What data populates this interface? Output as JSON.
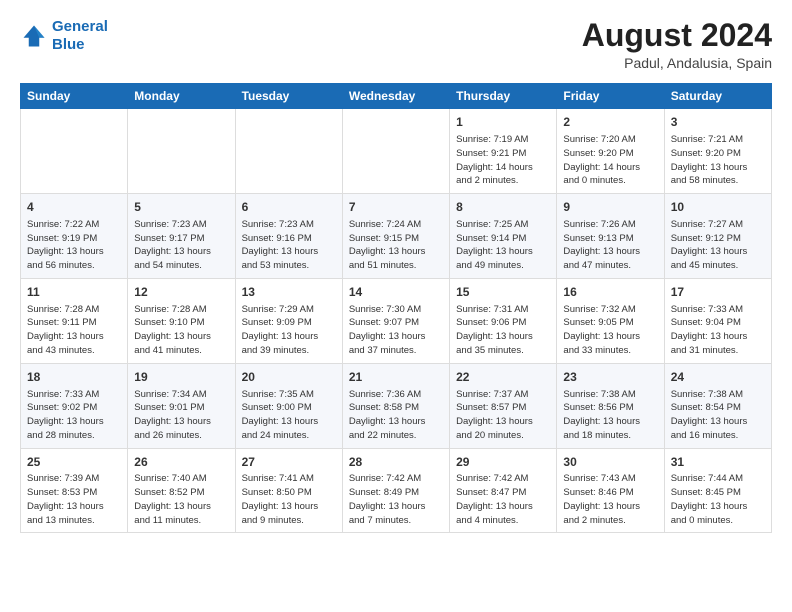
{
  "header": {
    "logo_line1": "General",
    "logo_line2": "Blue",
    "title": "August 2024",
    "subtitle": "Padul, Andalusia, Spain"
  },
  "calendar": {
    "days_of_week": [
      "Sunday",
      "Monday",
      "Tuesday",
      "Wednesday",
      "Thursday",
      "Friday",
      "Saturday"
    ],
    "weeks": [
      [
        {
          "day": "",
          "info": ""
        },
        {
          "day": "",
          "info": ""
        },
        {
          "day": "",
          "info": ""
        },
        {
          "day": "",
          "info": ""
        },
        {
          "day": "1",
          "info": "Sunrise: 7:19 AM\nSunset: 9:21 PM\nDaylight: 14 hours\nand 2 minutes."
        },
        {
          "day": "2",
          "info": "Sunrise: 7:20 AM\nSunset: 9:20 PM\nDaylight: 14 hours\nand 0 minutes."
        },
        {
          "day": "3",
          "info": "Sunrise: 7:21 AM\nSunset: 9:20 PM\nDaylight: 13 hours\nand 58 minutes."
        }
      ],
      [
        {
          "day": "4",
          "info": "Sunrise: 7:22 AM\nSunset: 9:19 PM\nDaylight: 13 hours\nand 56 minutes."
        },
        {
          "day": "5",
          "info": "Sunrise: 7:23 AM\nSunset: 9:17 PM\nDaylight: 13 hours\nand 54 minutes."
        },
        {
          "day": "6",
          "info": "Sunrise: 7:23 AM\nSunset: 9:16 PM\nDaylight: 13 hours\nand 53 minutes."
        },
        {
          "day": "7",
          "info": "Sunrise: 7:24 AM\nSunset: 9:15 PM\nDaylight: 13 hours\nand 51 minutes."
        },
        {
          "day": "8",
          "info": "Sunrise: 7:25 AM\nSunset: 9:14 PM\nDaylight: 13 hours\nand 49 minutes."
        },
        {
          "day": "9",
          "info": "Sunrise: 7:26 AM\nSunset: 9:13 PM\nDaylight: 13 hours\nand 47 minutes."
        },
        {
          "day": "10",
          "info": "Sunrise: 7:27 AM\nSunset: 9:12 PM\nDaylight: 13 hours\nand 45 minutes."
        }
      ],
      [
        {
          "day": "11",
          "info": "Sunrise: 7:28 AM\nSunset: 9:11 PM\nDaylight: 13 hours\nand 43 minutes."
        },
        {
          "day": "12",
          "info": "Sunrise: 7:28 AM\nSunset: 9:10 PM\nDaylight: 13 hours\nand 41 minutes."
        },
        {
          "day": "13",
          "info": "Sunrise: 7:29 AM\nSunset: 9:09 PM\nDaylight: 13 hours\nand 39 minutes."
        },
        {
          "day": "14",
          "info": "Sunrise: 7:30 AM\nSunset: 9:07 PM\nDaylight: 13 hours\nand 37 minutes."
        },
        {
          "day": "15",
          "info": "Sunrise: 7:31 AM\nSunset: 9:06 PM\nDaylight: 13 hours\nand 35 minutes."
        },
        {
          "day": "16",
          "info": "Sunrise: 7:32 AM\nSunset: 9:05 PM\nDaylight: 13 hours\nand 33 minutes."
        },
        {
          "day": "17",
          "info": "Sunrise: 7:33 AM\nSunset: 9:04 PM\nDaylight: 13 hours\nand 31 minutes."
        }
      ],
      [
        {
          "day": "18",
          "info": "Sunrise: 7:33 AM\nSunset: 9:02 PM\nDaylight: 13 hours\nand 28 minutes."
        },
        {
          "day": "19",
          "info": "Sunrise: 7:34 AM\nSunset: 9:01 PM\nDaylight: 13 hours\nand 26 minutes."
        },
        {
          "day": "20",
          "info": "Sunrise: 7:35 AM\nSunset: 9:00 PM\nDaylight: 13 hours\nand 24 minutes."
        },
        {
          "day": "21",
          "info": "Sunrise: 7:36 AM\nSunset: 8:58 PM\nDaylight: 13 hours\nand 22 minutes."
        },
        {
          "day": "22",
          "info": "Sunrise: 7:37 AM\nSunset: 8:57 PM\nDaylight: 13 hours\nand 20 minutes."
        },
        {
          "day": "23",
          "info": "Sunrise: 7:38 AM\nSunset: 8:56 PM\nDaylight: 13 hours\nand 18 minutes."
        },
        {
          "day": "24",
          "info": "Sunrise: 7:38 AM\nSunset: 8:54 PM\nDaylight: 13 hours\nand 16 minutes."
        }
      ],
      [
        {
          "day": "25",
          "info": "Sunrise: 7:39 AM\nSunset: 8:53 PM\nDaylight: 13 hours\nand 13 minutes."
        },
        {
          "day": "26",
          "info": "Sunrise: 7:40 AM\nSunset: 8:52 PM\nDaylight: 13 hours\nand 11 minutes."
        },
        {
          "day": "27",
          "info": "Sunrise: 7:41 AM\nSunset: 8:50 PM\nDaylight: 13 hours\nand 9 minutes."
        },
        {
          "day": "28",
          "info": "Sunrise: 7:42 AM\nSunset: 8:49 PM\nDaylight: 13 hours\nand 7 minutes."
        },
        {
          "day": "29",
          "info": "Sunrise: 7:42 AM\nSunset: 8:47 PM\nDaylight: 13 hours\nand 4 minutes."
        },
        {
          "day": "30",
          "info": "Sunrise: 7:43 AM\nSunset: 8:46 PM\nDaylight: 13 hours\nand 2 minutes."
        },
        {
          "day": "31",
          "info": "Sunrise: 7:44 AM\nSunset: 8:45 PM\nDaylight: 13 hours\nand 0 minutes."
        }
      ]
    ]
  }
}
